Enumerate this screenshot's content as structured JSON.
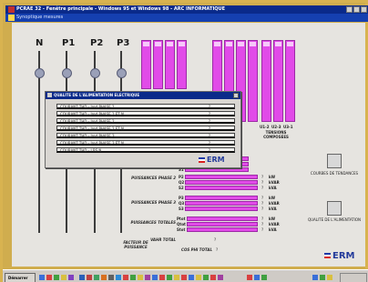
{
  "window": {
    "title": "PCRAE 32 - Fenêtre principale - Windows 95 et Windows 98 - ARC INFORMATIQUE",
    "subtitle": "Synoptique mesures"
  },
  "phases": [
    "N",
    "P1",
    "P2",
    "P3"
  ],
  "meter_group_label": "TENSIONS COMPOSEES",
  "meter_group_codes": [
    "U1-2",
    "U2-3",
    "U3-1"
  ],
  "rows": [
    {
      "label": "PHASE 1",
      "lines": [
        "P1",
        "Q1",
        "S1"
      ]
    },
    {
      "label": "PUISSANCES PHASE 2",
      "lines": [
        "P2",
        "Q2",
        "S2"
      ]
    },
    {
      "label": "PUISSANCES PHASE 3",
      "lines": [
        "P3",
        "Q3",
        "S3"
      ]
    },
    {
      "label": "PUISSANCES TOTALES",
      "lines": [
        "Ptot",
        "Qtot",
        "Stot"
      ]
    }
  ],
  "row_value": "?",
  "units": [
    "kW",
    "kVAR",
    "kVA"
  ],
  "vahr_total": {
    "label": "VAHR TOTAL",
    "value": "?"
  },
  "factor": {
    "label": "FACTEUR DE PUISSANCE",
    "value": ""
  },
  "cos_phi": {
    "label": "COS PHI TOTAL",
    "value": "?"
  },
  "side": {
    "trends": "COURBES DE TENDANCES",
    "quality": "QUALITE DE L'ALIMENTATION"
  },
  "brand": "ERM",
  "dialog": {
    "title": "QUALITE DE L'ALIMENTATION ELECTRIQUE",
    "rows": [
      {
        "label": "COURANT THD - Ired PHASE 1",
        "value": "?"
      },
      {
        "label": "COURANT THD - Ired PHASE 1 ET N",
        "value": "?"
      },
      {
        "label": "COURANT THD - Ired PHASE 2",
        "value": "?"
      },
      {
        "label": "COURANT THD - Ired PHASE 2 ET N",
        "value": "?"
      },
      {
        "label": "COURANT THD - Ired PHASE 3",
        "value": "?"
      },
      {
        "label": "COURANT THD - Ired PHASE 3 ET N",
        "value": "?"
      },
      {
        "label": "COURANT THD - I BS N",
        "value": "?"
      }
    ]
  },
  "taskbar": {
    "start": "Démarrer",
    "clock": ""
  },
  "colors": {
    "accent": "#e14be8",
    "title": "#0a2a8a"
  }
}
